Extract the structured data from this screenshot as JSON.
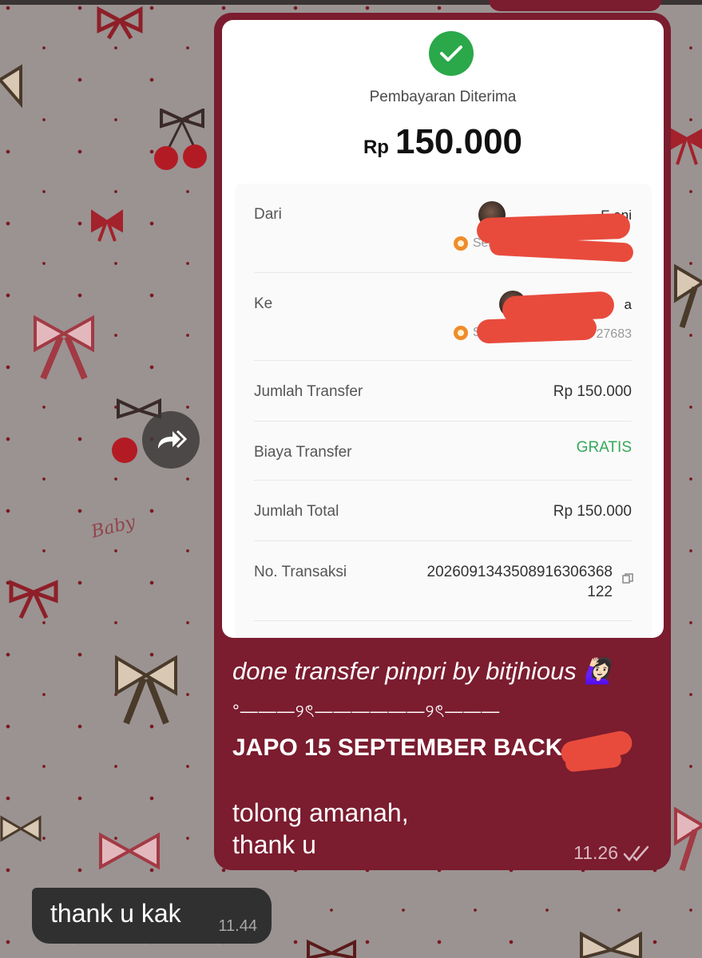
{
  "receipt": {
    "status": "Pembayaran Diterima",
    "currency": "Rp",
    "amount": "150.000",
    "from": {
      "label": "Dari",
      "name_visible": "E          ani",
      "bank_visible": "SeaB"
    },
    "to": {
      "label": "Ke",
      "name_visible": "a",
      "bank_visible": "SeaB",
      "account_tail_visible": "27683"
    },
    "rows": [
      {
        "label": "Jumlah Transfer",
        "value": "Rp 150.000"
      },
      {
        "label": "Biaya Transfer",
        "value": "GRATIS"
      },
      {
        "label": "Jumlah Total",
        "value": "Rp 150.000"
      }
    ],
    "transaction": {
      "label": "No. Transaksi",
      "value_line1": "20260913435089163063​68",
      "value_line2": "122"
    }
  },
  "caption": {
    "line1": "done transfer pinpri by bitjhious 🙋🏻‍♀️",
    "divider": "°———୨ৎ——————୨ৎ———",
    "line3": "JAPO 15 SEPTEMBER BACK",
    "line4": "tolong amanah,",
    "line5": "thank u",
    "time": "11.26"
  },
  "incoming": {
    "text": "thank u kak",
    "time": "11.44"
  },
  "wallpaper": {
    "text": "Baby"
  },
  "icons": {
    "status": "check-circle-icon",
    "forward": "forward-icon",
    "read": "double-check-icon",
    "copy": "copy-icon",
    "bank": "seabank-icon"
  },
  "colors": {
    "bubble_out": "#7b1c2f",
    "bubble_in": "#303030",
    "success": "#2aa84a",
    "free": "#35a85a",
    "redaction": "#e84b3c"
  }
}
